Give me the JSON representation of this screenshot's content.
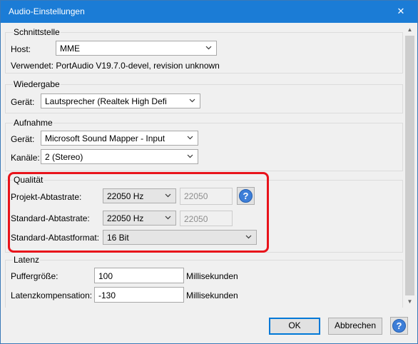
{
  "window": {
    "title": "Audio-Einstellungen",
    "close_glyph": "✕"
  },
  "schnittstelle": {
    "title": "Schnittstelle",
    "host_label": "Host:",
    "host_value": "MME",
    "version_text": "Verwendet: PortAudio V19.7.0-devel, revision unknown"
  },
  "wiedergabe": {
    "title": "Wiedergabe",
    "device_label": "Gerät:",
    "device_value": "Lautsprecher (Realtek High Defi"
  },
  "aufnahme": {
    "title": "Aufnahme",
    "device_label": "Gerät:",
    "device_value": "Microsoft Sound Mapper - Input",
    "channels_label": "Kanäle:",
    "channels_value": "2 (Stereo)"
  },
  "qualitaet": {
    "title": "Qualität",
    "project_rate_label": "Projekt-Abtastrate:",
    "project_rate_value": "22050 Hz",
    "project_rate_custom": "22050",
    "default_rate_label": "Standard-Abtastrate:",
    "default_rate_value": "22050 Hz",
    "default_rate_custom": "22050",
    "format_label": "Standard-Abtastformat:",
    "format_value": "16 Bit",
    "help_glyph": "?"
  },
  "latenz": {
    "title": "Latenz",
    "buffer_label": "Puffergröße:",
    "buffer_value": "100",
    "buffer_unit": "Millisekunden",
    "comp_label": "Latenzkompensation:",
    "comp_value": "-130",
    "comp_unit": "Millisekunden"
  },
  "buttons": {
    "ok": "OK",
    "cancel": "Abbrechen",
    "help": "?"
  },
  "colors": {
    "titlebar": "#1b7cd6",
    "highlight": "#e8131b",
    "help_icon": "#3d7ed8"
  }
}
